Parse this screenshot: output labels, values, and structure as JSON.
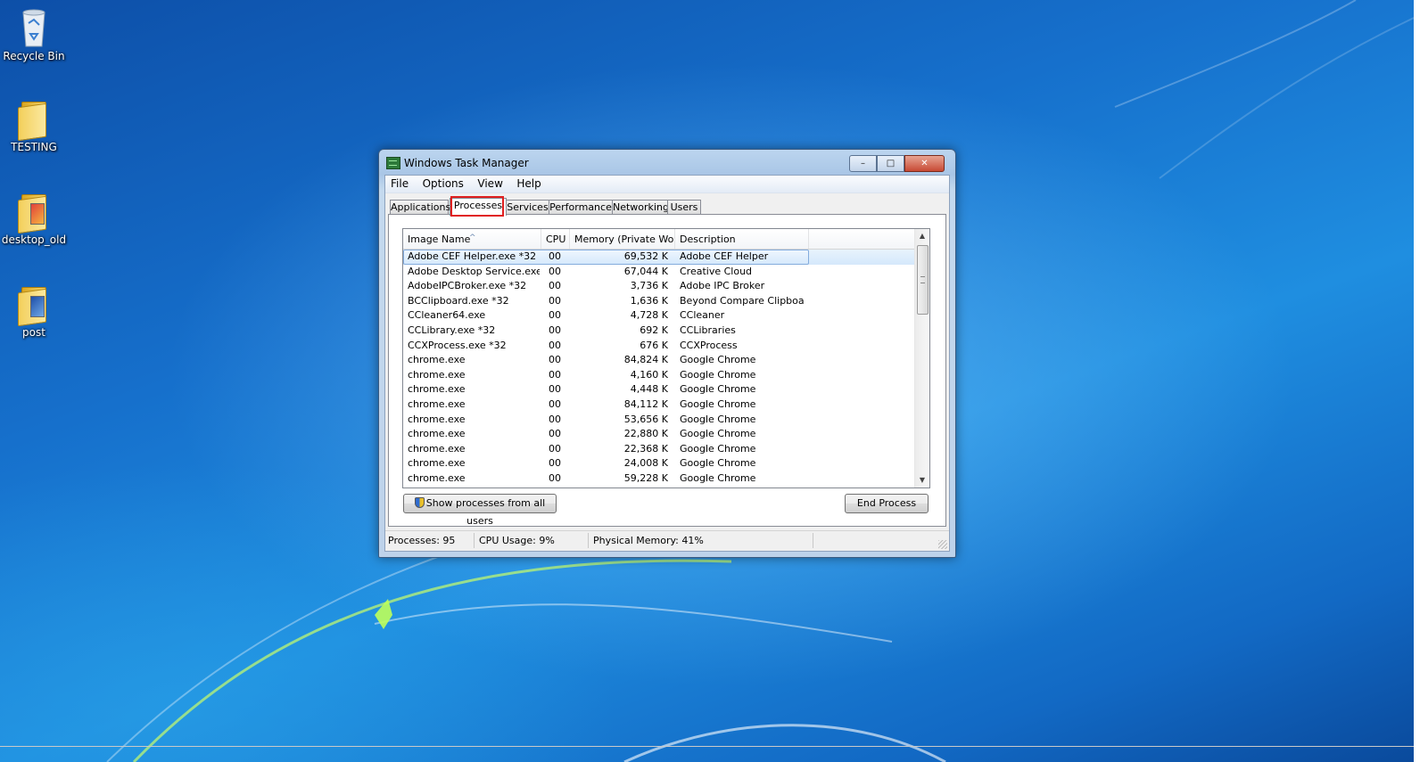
{
  "desktop": {
    "icons": [
      {
        "label": "Recycle Bin"
      },
      {
        "label": "TESTING"
      },
      {
        "label": "desktop_old"
      },
      {
        "label": "post"
      }
    ]
  },
  "window": {
    "title": "Windows Task Manager",
    "caption_buttons": {
      "minimize": "–",
      "maximize": "□",
      "close": "✕"
    }
  },
  "menu": {
    "items": [
      "File",
      "Options",
      "View",
      "Help"
    ]
  },
  "tabs": {
    "items": [
      "Applications",
      "Processes",
      "Services",
      "Performance",
      "Networking",
      "Users"
    ],
    "active": "Processes",
    "highlight_color": "#e02020"
  },
  "table": {
    "headers": [
      "Image Name",
      "CPU",
      "Memory (Private Wo...",
      "Description"
    ],
    "sort_indicator": "^",
    "selected_row": 0,
    "rows": [
      {
        "name": "Adobe CEF Helper.exe *32",
        "cpu": "00",
        "mem": "69,532 K",
        "desc": "Adobe CEF Helper"
      },
      {
        "name": "Adobe Desktop Service.exe ...",
        "cpu": "00",
        "mem": "67,044 K",
        "desc": "Creative Cloud"
      },
      {
        "name": "AdobeIPCBroker.exe *32",
        "cpu": "00",
        "mem": "3,736 K",
        "desc": "Adobe IPC Broker"
      },
      {
        "name": "BCClipboard.exe *32",
        "cpu": "00",
        "mem": "1,636 K",
        "desc": "Beyond Compare Clipboar..."
      },
      {
        "name": "CCleaner64.exe",
        "cpu": "00",
        "mem": "4,728 K",
        "desc": "CCleaner"
      },
      {
        "name": "CCLibrary.exe *32",
        "cpu": "00",
        "mem": "692 K",
        "desc": "CCLibraries"
      },
      {
        "name": "CCXProcess.exe *32",
        "cpu": "00",
        "mem": "676 K",
        "desc": "CCXProcess"
      },
      {
        "name": "chrome.exe",
        "cpu": "00",
        "mem": "84,824 K",
        "desc": "Google Chrome"
      },
      {
        "name": "chrome.exe",
        "cpu": "00",
        "mem": "4,160 K",
        "desc": "Google Chrome"
      },
      {
        "name": "chrome.exe",
        "cpu": "00",
        "mem": "4,448 K",
        "desc": "Google Chrome"
      },
      {
        "name": "chrome.exe",
        "cpu": "00",
        "mem": "84,112 K",
        "desc": "Google Chrome"
      },
      {
        "name": "chrome.exe",
        "cpu": "00",
        "mem": "53,656 K",
        "desc": "Google Chrome"
      },
      {
        "name": "chrome.exe",
        "cpu": "00",
        "mem": "22,880 K",
        "desc": "Google Chrome"
      },
      {
        "name": "chrome.exe",
        "cpu": "00",
        "mem": "22,368 K",
        "desc": "Google Chrome"
      },
      {
        "name": "chrome.exe",
        "cpu": "00",
        "mem": "24,008 K",
        "desc": "Google Chrome"
      },
      {
        "name": "chrome.exe",
        "cpu": "00",
        "mem": "59,228 K",
        "desc": "Google Chrome"
      }
    ]
  },
  "buttons": {
    "show_all": "Show processes from all users",
    "end_process": "End Process"
  },
  "status": {
    "processes": "Processes: 95",
    "cpu": "CPU Usage: 9%",
    "memory": "Physical Memory: 41%"
  }
}
